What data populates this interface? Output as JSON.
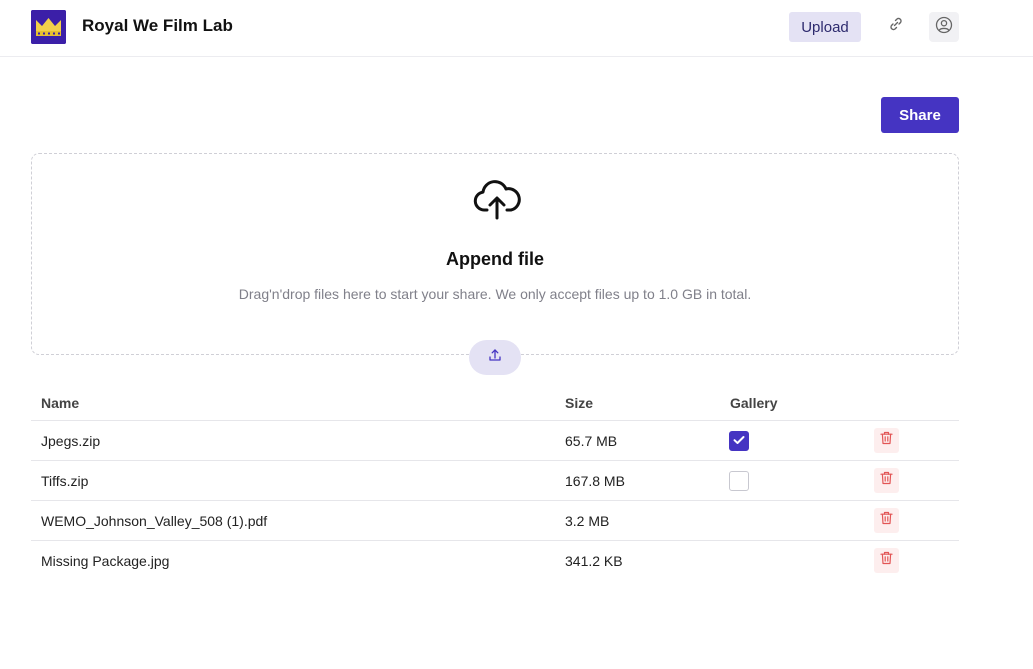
{
  "app": {
    "title": "Royal We Film Lab",
    "upload_label": "Upload"
  },
  "toolbar": {
    "share_label": "Share"
  },
  "dropzone": {
    "title": "Append file",
    "description": "Drag'n'drop files here to start your share. We only accept files up to 1.0 GB in total."
  },
  "table": {
    "headers": {
      "name": "Name",
      "size": "Size",
      "gallery": "Gallery"
    },
    "rows": [
      {
        "name": "Jpegs.zip",
        "size": "65.7 MB",
        "gallery": "checked"
      },
      {
        "name": "Tiffs.zip",
        "size": "167.8 MB",
        "gallery": "unchecked"
      },
      {
        "name": "WEMO_Johnson_Valley_508 (1).pdf",
        "size": "3.2 MB",
        "gallery": "none"
      },
      {
        "name": "Missing Package.jpg",
        "size": "341.2 KB",
        "gallery": "none"
      }
    ]
  },
  "icons": {
    "logo": "crown-film-logo",
    "link": "link-icon",
    "user": "user-circle-icon",
    "cloud": "cloud-upload-icon",
    "upload": "upload-icon",
    "delete": "trash-icon",
    "check": "check-icon"
  },
  "colors": {
    "accent": "#4534c2",
    "accent_soft": "#e4e2f4",
    "logo_bg": "#3b1fa8",
    "logo_crown": "#f2d14a",
    "danger": "#e25555",
    "danger_soft": "#fdeeee"
  }
}
